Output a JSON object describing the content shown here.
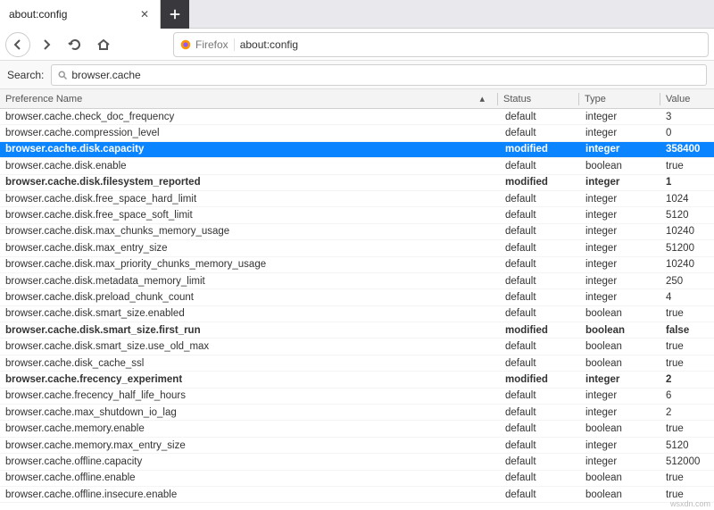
{
  "tab": {
    "title": "about:config"
  },
  "identity": {
    "label": "Firefox"
  },
  "url": "about:config",
  "search": {
    "label": "Search:",
    "value": "browser.cache"
  },
  "columns": {
    "name": "Preference Name",
    "status": "Status",
    "type": "Type",
    "value": "Value"
  },
  "rows": [
    {
      "name": "browser.cache.check_doc_frequency",
      "status": "default",
      "type": "integer",
      "value": "3",
      "modified": false,
      "selected": false
    },
    {
      "name": "browser.cache.compression_level",
      "status": "default",
      "type": "integer",
      "value": "0",
      "modified": false,
      "selected": false
    },
    {
      "name": "browser.cache.disk.capacity",
      "status": "modified",
      "type": "integer",
      "value": "358400",
      "modified": true,
      "selected": true
    },
    {
      "name": "browser.cache.disk.enable",
      "status": "default",
      "type": "boolean",
      "value": "true",
      "modified": false,
      "selected": false
    },
    {
      "name": "browser.cache.disk.filesystem_reported",
      "status": "modified",
      "type": "integer",
      "value": "1",
      "modified": true,
      "selected": false
    },
    {
      "name": "browser.cache.disk.free_space_hard_limit",
      "status": "default",
      "type": "integer",
      "value": "1024",
      "modified": false,
      "selected": false
    },
    {
      "name": "browser.cache.disk.free_space_soft_limit",
      "status": "default",
      "type": "integer",
      "value": "5120",
      "modified": false,
      "selected": false
    },
    {
      "name": "browser.cache.disk.max_chunks_memory_usage",
      "status": "default",
      "type": "integer",
      "value": "10240",
      "modified": false,
      "selected": false
    },
    {
      "name": "browser.cache.disk.max_entry_size",
      "status": "default",
      "type": "integer",
      "value": "51200",
      "modified": false,
      "selected": false
    },
    {
      "name": "browser.cache.disk.max_priority_chunks_memory_usage",
      "status": "default",
      "type": "integer",
      "value": "10240",
      "modified": false,
      "selected": false
    },
    {
      "name": "browser.cache.disk.metadata_memory_limit",
      "status": "default",
      "type": "integer",
      "value": "250",
      "modified": false,
      "selected": false
    },
    {
      "name": "browser.cache.disk.preload_chunk_count",
      "status": "default",
      "type": "integer",
      "value": "4",
      "modified": false,
      "selected": false
    },
    {
      "name": "browser.cache.disk.smart_size.enabled",
      "status": "default",
      "type": "boolean",
      "value": "true",
      "modified": false,
      "selected": false
    },
    {
      "name": "browser.cache.disk.smart_size.first_run",
      "status": "modified",
      "type": "boolean",
      "value": "false",
      "modified": true,
      "selected": false
    },
    {
      "name": "browser.cache.disk.smart_size.use_old_max",
      "status": "default",
      "type": "boolean",
      "value": "true",
      "modified": false,
      "selected": false
    },
    {
      "name": "browser.cache.disk_cache_ssl",
      "status": "default",
      "type": "boolean",
      "value": "true",
      "modified": false,
      "selected": false
    },
    {
      "name": "browser.cache.frecency_experiment",
      "status": "modified",
      "type": "integer",
      "value": "2",
      "modified": true,
      "selected": false
    },
    {
      "name": "browser.cache.frecency_half_life_hours",
      "status": "default",
      "type": "integer",
      "value": "6",
      "modified": false,
      "selected": false
    },
    {
      "name": "browser.cache.max_shutdown_io_lag",
      "status": "default",
      "type": "integer",
      "value": "2",
      "modified": false,
      "selected": false
    },
    {
      "name": "browser.cache.memory.enable",
      "status": "default",
      "type": "boolean",
      "value": "true",
      "modified": false,
      "selected": false
    },
    {
      "name": "browser.cache.memory.max_entry_size",
      "status": "default",
      "type": "integer",
      "value": "5120",
      "modified": false,
      "selected": false
    },
    {
      "name": "browser.cache.offline.capacity",
      "status": "default",
      "type": "integer",
      "value": "512000",
      "modified": false,
      "selected": false
    },
    {
      "name": "browser.cache.offline.enable",
      "status": "default",
      "type": "boolean",
      "value": "true",
      "modified": false,
      "selected": false
    },
    {
      "name": "browser.cache.offline.insecure.enable",
      "status": "default",
      "type": "boolean",
      "value": "true",
      "modified": false,
      "selected": false
    }
  ],
  "watermark": "wsxdn.com"
}
